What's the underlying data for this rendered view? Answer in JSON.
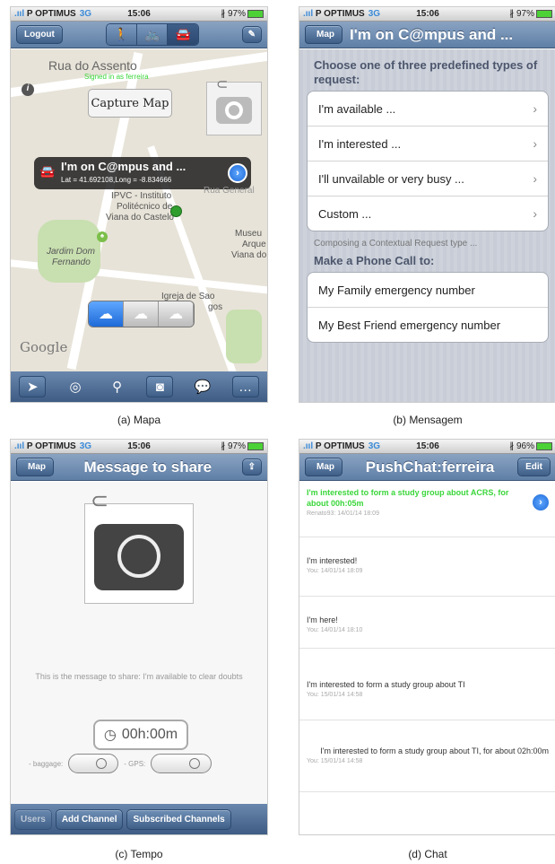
{
  "status": {
    "carrier": "P OPTIMUS",
    "network": "3G",
    "time": "15:06",
    "battery_a": "97%",
    "battery_b": "97%",
    "battery_c": "97%",
    "battery_d": "96%"
  },
  "screen_a": {
    "caption": "(a) Mapa",
    "logout": "Logout",
    "street": "Rua do Assento",
    "signed_in": "Signed in as ferreira",
    "capture": "Capture Map",
    "callout_title": "I'm on C@mpus and ...",
    "callout_sub": "Lat = 41.692108,Long = -8.834666",
    "labels": [
      "IPVC - Instituto",
      "Politécnico de",
      "Viana do Castelo",
      "Jardim Dom",
      "Fernando",
      "Museu",
      "Arque",
      "Viana do",
      "Igreja de Sao",
      "gos",
      "Rua General"
    ],
    "google": "Google"
  },
  "screen_b": {
    "caption": "(b) Mensagem",
    "back": "Map",
    "title": "I'm on C@mpus and ...",
    "header": "Choose one of three predefined types of request:",
    "options": [
      "I'm available ...",
      "I'm interested ...",
      "I'll unvailable or very busy ...",
      "Custom ..."
    ],
    "hint": "Composing a Contextual Request type ...",
    "phone_header": "Make a Phone Call to:",
    "phones": [
      "My Family emergency number",
      "My Best Friend emergency number"
    ]
  },
  "screen_c": {
    "caption": "(c) Tempo",
    "back": "Map",
    "title": "Message to share",
    "share_text": "This is the message to share: I'm available  to clear doubts",
    "timer": "00h:00m",
    "baggage": "- baggage:",
    "gps": "- GPS:",
    "buttons": [
      "Users",
      "Add Channel",
      "Subscribed Channels"
    ]
  },
  "screen_d": {
    "caption": "(d) Chat",
    "back": "Map",
    "title": "PushChat:ferreira",
    "edit": "Edit",
    "messages": [
      {
        "text": "I'm interested to form a study group about ACRS, for about 00h:05m",
        "meta": "Renato93: 14/01/14 18:09"
      },
      {
        "text": "I'm interested!",
        "meta": "You: 14/01/14 18:09"
      },
      {
        "text": "I'm here!",
        "meta": "You: 14/01/14 18:10"
      },
      {
        "text": "I'm interested to form a study group about TI",
        "meta": "You: 15/01/14 14:58"
      },
      {
        "text": "I'm interested to form a study group about TI, for about 02h:00m",
        "meta": "You: 15/01/14 14:58"
      }
    ]
  }
}
